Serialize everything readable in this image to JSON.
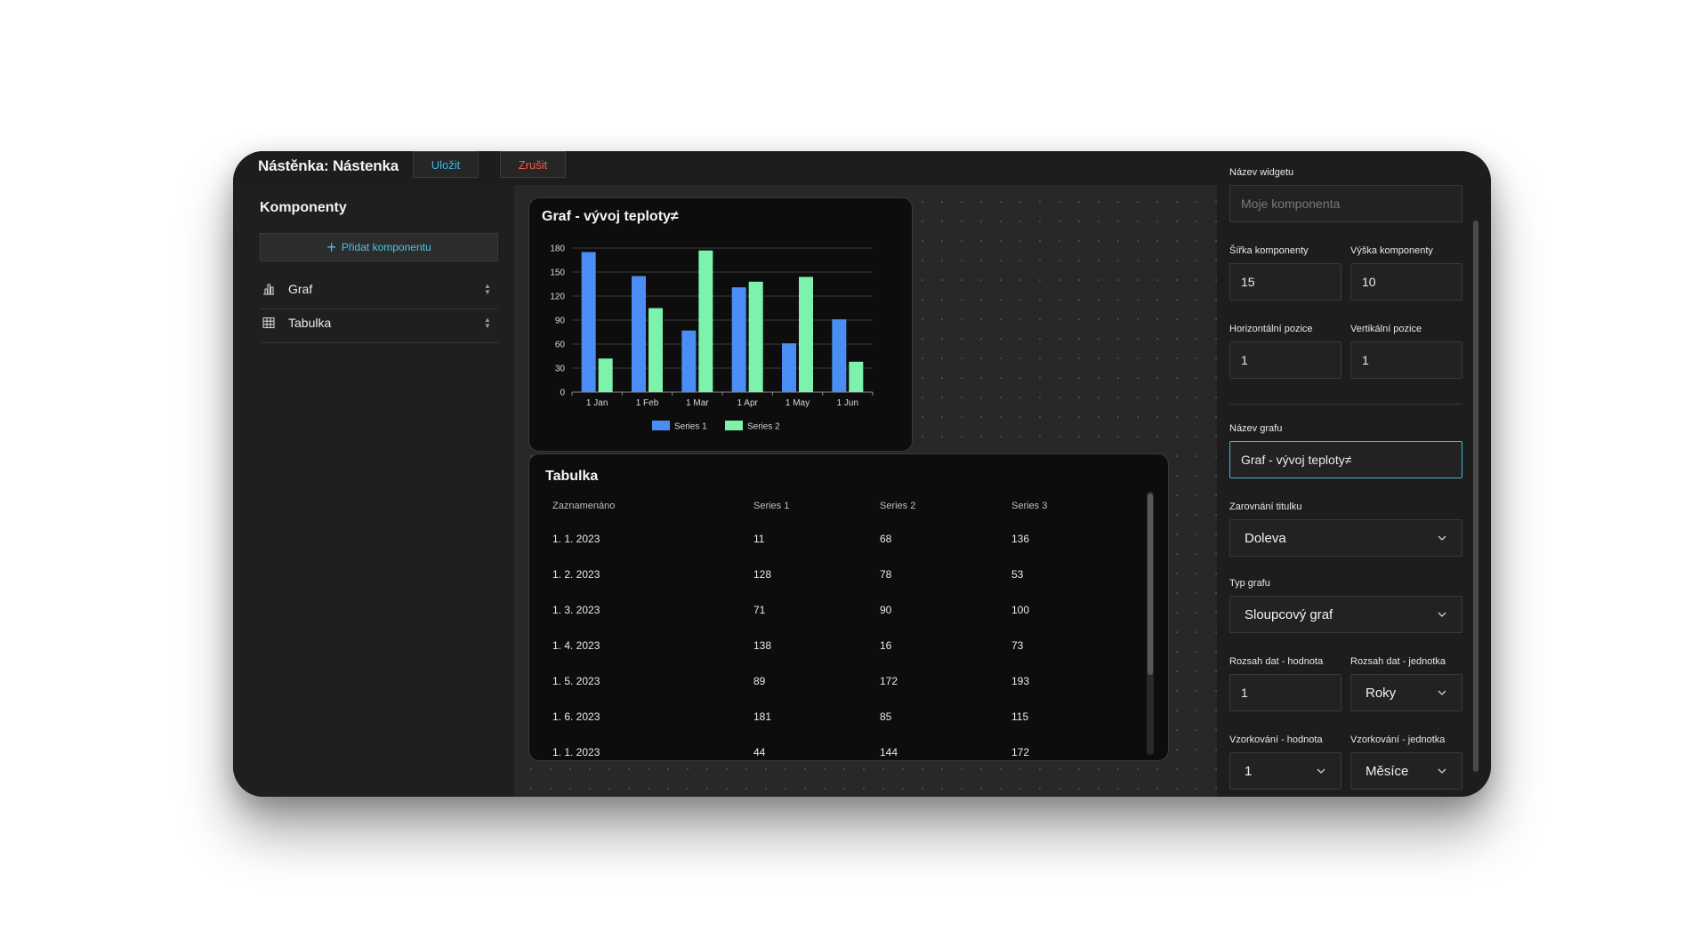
{
  "header": {
    "title": "Nástěnka: Nástenka",
    "save_label": "Uložit",
    "cancel_label": "Zrušit"
  },
  "sidebar": {
    "title": "Komponenty",
    "add_label": "Přidat komponentu",
    "items": [
      {
        "label": "Graf",
        "icon": "bar-chart-icon"
      },
      {
        "label": "Tabulka",
        "icon": "table-icon"
      }
    ]
  },
  "chart": {
    "title": "Graf - vývoj teploty≠"
  },
  "chart_data": {
    "type": "bar",
    "title": "Graf - vývoj teploty≠",
    "categories": [
      "1 Jan",
      "1 Feb",
      "1 Mar",
      "1 Apr",
      "1 May",
      "1 Jun"
    ],
    "series": [
      {
        "name": "Series 1",
        "color": "#4a8ef5",
        "values": [
          175,
          145,
          77,
          131,
          61,
          91
        ]
      },
      {
        "name": "Series 2",
        "color": "#7df2ac",
        "values": [
          42,
          105,
          177,
          138,
          144,
          38
        ]
      }
    ],
    "yticks": [
      0,
      30,
      60,
      90,
      120,
      150,
      180
    ],
    "ylim": [
      0,
      180
    ],
    "legend_position": "bottom",
    "grid": true
  },
  "table": {
    "title": "Tabulka",
    "headers": [
      "Zaznamenáno",
      "Series 1",
      "Series 2",
      "Series 3"
    ],
    "rows": [
      [
        "1. 1. 2023",
        "11",
        "68",
        "136"
      ],
      [
        "1. 2. 2023",
        "128",
        "78",
        "53"
      ],
      [
        "1. 3. 2023",
        "71",
        "90",
        "100"
      ],
      [
        "1. 4. 2023",
        "138",
        "16",
        "73"
      ],
      [
        "1. 5. 2023",
        "89",
        "172",
        "193"
      ],
      [
        "1. 6. 2023",
        "181",
        "85",
        "115"
      ],
      [
        "1. 1. 2023",
        "44",
        "144",
        "172"
      ]
    ]
  },
  "panel": {
    "widget_name_label": "Název widgetu",
    "widget_name_placeholder": "Moje komponenta",
    "width_label": "Šířka komponenty",
    "width_value": "15",
    "height_label": "Výška komponenty",
    "height_value": "10",
    "hpos_label": "Horizontální pozice",
    "hpos_value": "1",
    "vpos_label": "Vertikální pozice",
    "vpos_value": "1",
    "chart_name_label": "Název grafu",
    "chart_name_value": "Graf - vývoj teploty≠",
    "title_align_label": "Zarovnání titulku",
    "title_align_value": "Doleva",
    "chart_type_label": "Typ grafu",
    "chart_type_value": "Sloupcový graf",
    "range_value_label": "Rozsah dat - hodnota",
    "range_value": "1",
    "range_unit_label": "Rozsah dat - jednotka",
    "range_unit_value": "Roky",
    "sampling_value_label": "Vzorkování - hodnota",
    "sampling_value": "1",
    "sampling_unit_label": "Vzorkování - jednotka",
    "sampling_unit_value": "Měsíce"
  }
}
